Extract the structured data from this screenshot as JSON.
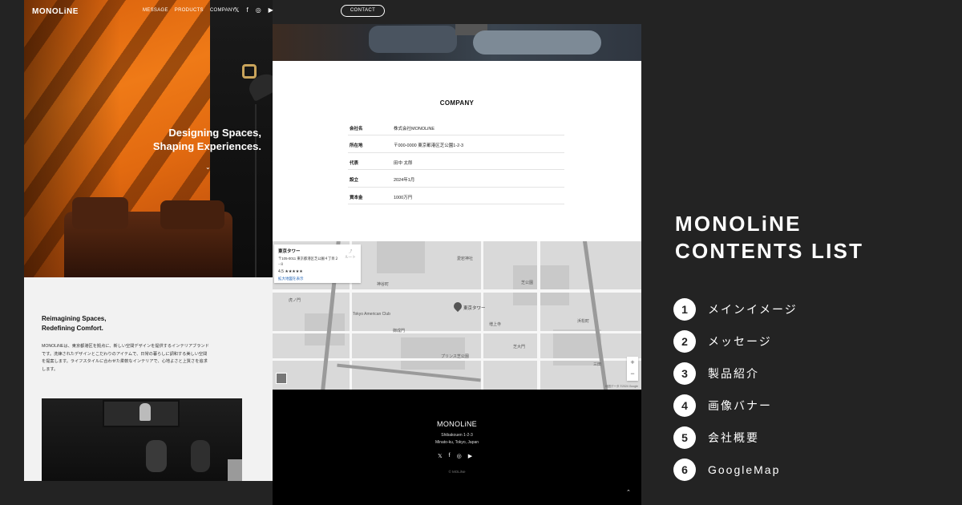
{
  "nav": {
    "logo": "MONOLiNE",
    "links": [
      "MESSAGE",
      "PRODUCTS",
      "COMPANY"
    ],
    "social_icons": [
      "x-icon",
      "facebook-icon",
      "instagram-icon",
      "youtube-icon"
    ],
    "contact_label": "CONTACT"
  },
  "hero": {
    "title_line1": "Designing Spaces,",
    "title_line2": "Shaping Experiences."
  },
  "message": {
    "title_line1": "Reimagining Spaces,",
    "title_line2": "Redefining Comfort.",
    "body": "MONOLiNEは、東京都港区を拠点に、新しい空間デザインを提供するインテリアブランドです。洗練されたデザインとこだわりのアイテムで、日常の暮らしに調和する美しい空間を提案します。ライフスタイルに合わせた柔軟なインテリアで、心地よさと上質さを追求します。"
  },
  "company": {
    "title": "COMPANY",
    "rows": [
      {
        "label": "会社名",
        "value": "株式会社MONOLiNE"
      },
      {
        "label": "所在地",
        "value": "〒000-0000 東京都港区芝公園1-2-3"
      },
      {
        "label": "代表",
        "value": "田中 太郎"
      },
      {
        "label": "設立",
        "value": "2024年1月"
      },
      {
        "label": "資本金",
        "value": "1000万円"
      }
    ]
  },
  "map": {
    "place_name": "東京タワー",
    "address": "〒105-0011 東京都港区芝公園４丁目２−８",
    "rating": "4.5 ★★★★★",
    "larger_map_link": "拡大地図を表示",
    "route_label": "ルート",
    "pin_label": "東京タワー",
    "zoom_in": "+",
    "zoom_out": "−",
    "credit": "地図データ ©2024 Google",
    "labels": [
      "愛宕神社",
      "芝公園",
      "Tokyo American Club",
      "浜松町",
      "神谷町",
      "東京タワー",
      "増上寺",
      "プリンス芝公園",
      "芝大門",
      "御成門",
      "虎ノ門",
      "三田"
    ]
  },
  "footer": {
    "logo": "MONOLiNE",
    "address_line1": "Shibakouen 1-2-3",
    "address_line2": "Minato-ku, Tokyo, Japan",
    "copyright": "© MOLiNe",
    "social_icons": [
      "x-icon",
      "facebook-icon",
      "instagram-icon",
      "youtube-icon"
    ]
  },
  "panel": {
    "title_line1": "MONOLiNE",
    "title_line2": "CONTENTS LIST",
    "items": [
      {
        "num": "1",
        "label": "メインイメージ"
      },
      {
        "num": "2",
        "label": "メッセージ"
      },
      {
        "num": "3",
        "label": "製品紹介"
      },
      {
        "num": "4",
        "label": "画像バナー"
      },
      {
        "num": "5",
        "label": "会社概要"
      },
      {
        "num": "6",
        "label": "GoogleMap"
      }
    ]
  }
}
